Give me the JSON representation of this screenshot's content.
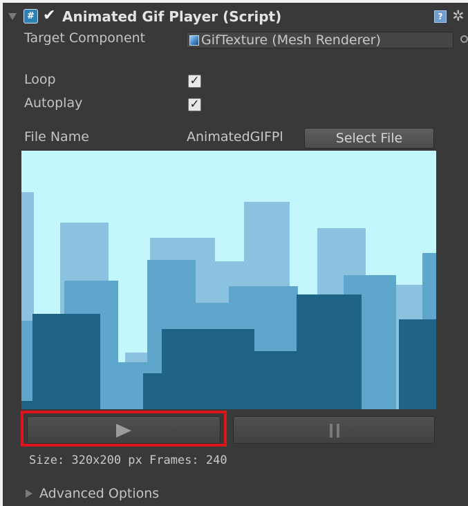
{
  "component": {
    "title": "Animated Gif Player (Script)",
    "enabled": true,
    "script_icon": "csharp-script-icon",
    "help_icon": "help-icon",
    "settings_icon": "gear-icon"
  },
  "fields": {
    "target_component_label": "Target Component",
    "target_component_value": "GifTexture (Mesh Renderer)",
    "loop_label": "Loop",
    "loop_checked": true,
    "autoplay_label": "Autoplay",
    "autoplay_checked": true,
    "file_name_label": "File Name",
    "file_name_value": "AnimatedGIFPl",
    "select_file_label": "Select File"
  },
  "controls": {
    "play_icon": "play-icon",
    "pause_icon": "pause-icon"
  },
  "info": {
    "text": "Size: 320x200 px Frames: 240"
  },
  "advanced": {
    "label": "Advanced Options",
    "expanded": false
  },
  "colors": {
    "sky": "#c4f6fd",
    "far": "#8ac2e0",
    "mid": "#5ea6cb",
    "near": "#1f6387",
    "highlight": "#e0141d",
    "panel": "#393939"
  }
}
